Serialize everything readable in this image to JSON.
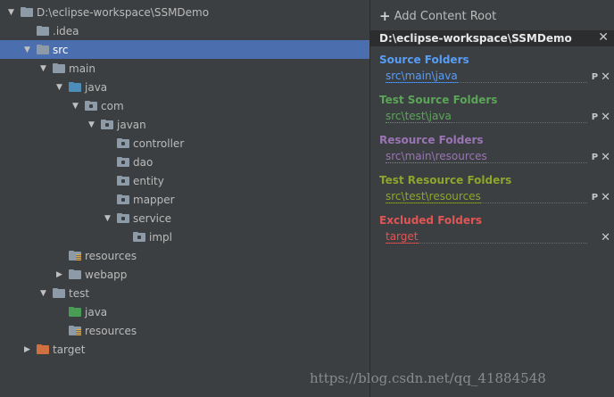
{
  "colors": {
    "background": "#3c3f41",
    "selection": "#4b6eaf",
    "folder_gray": "#8d9ba8",
    "source_blue": "#4d8dba",
    "test_green": "#499c54",
    "excluded_orange": "#d06f3f",
    "source_title": "#589df6",
    "test_title": "#5aa558",
    "resource_title": "#9a74b5",
    "test_resource_title": "#8da52c",
    "excluded_title": "#e05555"
  },
  "tree": [
    {
      "label": "D:\\eclipse-workspace\\SSMDemo",
      "level": 0,
      "arrow": "down",
      "icon": "folder",
      "color": "#8d9ba8"
    },
    {
      "label": ".idea",
      "level": 1,
      "arrow": "none",
      "icon": "folder",
      "color": "#8d9ba8"
    },
    {
      "label": "src",
      "level": 1,
      "arrow": "down",
      "icon": "folder",
      "color": "#8d9ba8",
      "selected": true
    },
    {
      "label": "main",
      "level": 2,
      "arrow": "down",
      "icon": "folder",
      "color": "#8d9ba8"
    },
    {
      "label": "java",
      "level": 3,
      "arrow": "down",
      "icon": "folder",
      "color": "#4d8dba"
    },
    {
      "label": "com",
      "level": 4,
      "arrow": "down",
      "icon": "package",
      "color": "#8d9ba8"
    },
    {
      "label": "javan",
      "level": 5,
      "arrow": "down",
      "icon": "package",
      "color": "#8d9ba8"
    },
    {
      "label": "controller",
      "level": 6,
      "arrow": "none",
      "icon": "package",
      "color": "#8d9ba8"
    },
    {
      "label": "dao",
      "level": 6,
      "arrow": "none",
      "icon": "package",
      "color": "#8d9ba8"
    },
    {
      "label": "entity",
      "level": 6,
      "arrow": "none",
      "icon": "package",
      "color": "#8d9ba8"
    },
    {
      "label": "mapper",
      "level": 6,
      "arrow": "none",
      "icon": "package",
      "color": "#8d9ba8"
    },
    {
      "label": "service",
      "level": 6,
      "arrow": "down",
      "icon": "package",
      "color": "#8d9ba8"
    },
    {
      "label": "impl",
      "level": 7,
      "arrow": "none",
      "icon": "package",
      "color": "#8d9ba8"
    },
    {
      "label": "resources",
      "level": 3,
      "arrow": "none",
      "icon": "resources",
      "color": "#8d9ba8"
    },
    {
      "label": "webapp",
      "level": 3,
      "arrow": "right",
      "icon": "folder",
      "color": "#8d9ba8"
    },
    {
      "label": "test",
      "level": 2,
      "arrow": "down",
      "icon": "folder",
      "color": "#8d9ba8"
    },
    {
      "label": "java",
      "level": 3,
      "arrow": "none",
      "icon": "folder",
      "color": "#499c54"
    },
    {
      "label": "resources",
      "level": 3,
      "arrow": "none",
      "icon": "resources",
      "color": "#8d9ba8"
    },
    {
      "label": "target",
      "level": 1,
      "arrow": "right",
      "icon": "folder",
      "color": "#d06f3f"
    }
  ],
  "right_panel": {
    "add_content_root": "Add Content Root",
    "root_path": "D:\\eclipse-workspace\\SSMDemo",
    "sections": [
      {
        "title": "Source Folders",
        "path": "src\\main\\java",
        "title_color": "#589df6",
        "path_color": "#589df6",
        "has_properties": true
      },
      {
        "title": "Test Source Folders",
        "path": "src\\test\\java",
        "title_color": "#5aa558",
        "path_color": "#5aa558",
        "has_properties": true
      },
      {
        "title": "Resource Folders",
        "path": "src\\main\\resources",
        "title_color": "#9a74b5",
        "path_color": "#9a74b5",
        "has_properties": true
      },
      {
        "title": "Test Resource Folders",
        "path": "src\\test\\resources",
        "title_color": "#8da52c",
        "path_color": "#8da52c",
        "has_properties": true
      },
      {
        "title": "Excluded Folders",
        "path": "target",
        "title_color": "#e05555",
        "path_color": "#e05555",
        "has_properties": false
      }
    ]
  },
  "watermark": "https://blog.csdn.net/qq_41884548"
}
